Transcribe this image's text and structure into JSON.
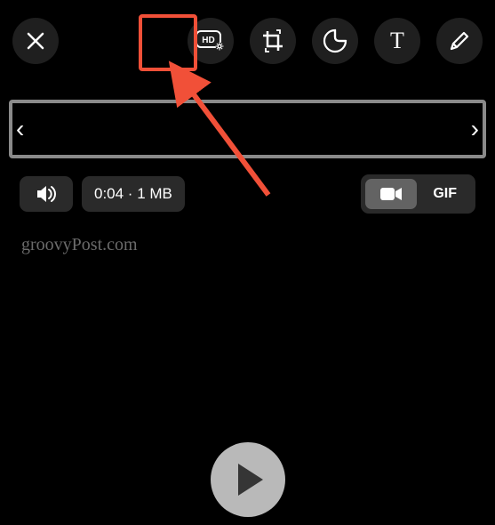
{
  "toolbar": {
    "close": "close-icon",
    "hd": "hd-quality-icon",
    "crop": "crop-rotate-icon",
    "sticker": "sticker-icon",
    "text": "text-icon",
    "text_label": "T",
    "draw": "draw-icon"
  },
  "trim": {
    "left": "‹",
    "right": "›"
  },
  "info": {
    "sound": "speaker-icon",
    "meta": "0:04 · 1 MB"
  },
  "format": {
    "video": "video-icon",
    "gif": "GIF"
  },
  "watermark": "groovyPost.com",
  "play": "play-icon",
  "annotation": {
    "highlight_color": "#f15038"
  }
}
